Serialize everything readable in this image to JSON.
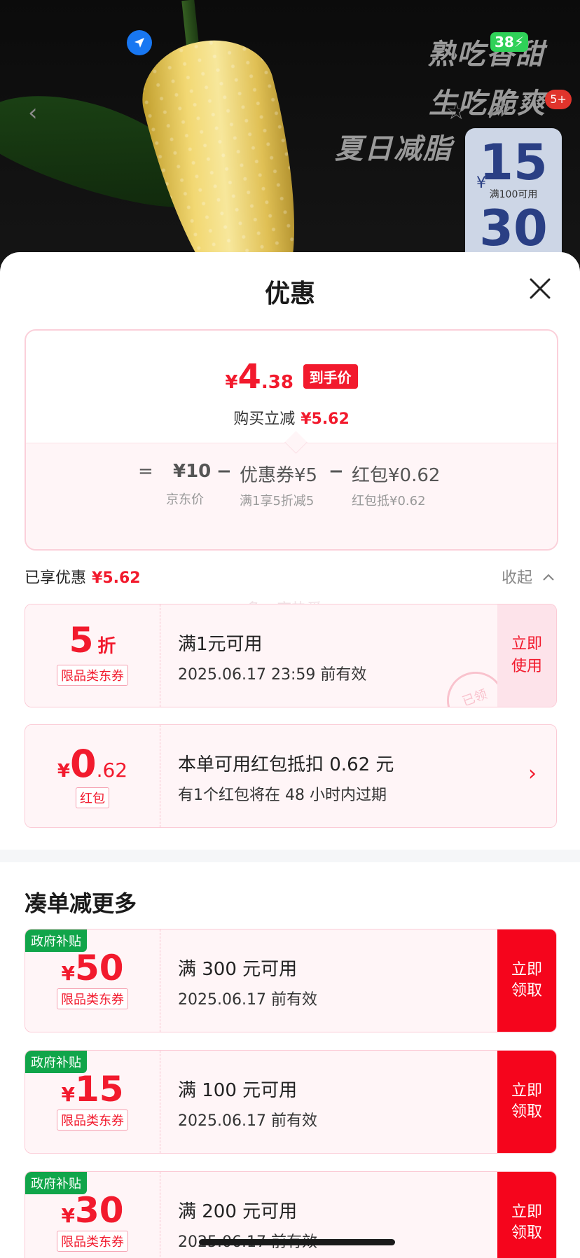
{
  "background": {
    "slogan_lines": [
      "熟吃香甜",
      "生吃脆爽",
      "夏日减脂"
    ],
    "battery": "38",
    "badge_count": "5+",
    "side_coupon": {
      "currency": "¥",
      "amount": "15",
      "condition": "满100可用",
      "amount2": "30"
    },
    "icons": [
      "location-arrow-icon",
      "back-icon",
      "star-icon",
      "share-icon"
    ]
  },
  "sheet": {
    "title": "优惠",
    "price_summary": {
      "currency": "¥",
      "price_int": "4",
      "price_dec": ".38",
      "price_tag": "到手价",
      "reduce_label": "购买立减",
      "reduce_amount": "¥5.62",
      "formula": {
        "eq": "=",
        "jd_price": "¥10",
        "minus1": "−",
        "coupon": "优惠券¥5",
        "minus2": "−",
        "redpacket": "红包¥0.62",
        "jd_label": "京东价",
        "coupon_note": "满1享5折减5",
        "redpacket_note": "红包抵¥0.62"
      }
    },
    "enjoyed_label": "已享优惠",
    "enjoyed_amount": "¥5.62",
    "collapse_label": "收起",
    "watermark": "多一度热爱",
    "applied": [
      {
        "value_int": "5",
        "value_unit": "折",
        "kind": "限品类东券",
        "title": "满1元可用",
        "expiry": "2025.06.17 23:59 前有效",
        "button": "立即使用",
        "stamp": "已领"
      },
      {
        "currency": "¥",
        "value_int": "0",
        "value_dec": ".62",
        "kind": "红包",
        "title": "本单可用红包抵扣 0.62 元",
        "expiry": "有1个红包将在 48 小时内过期"
      }
    ],
    "more_title": "凑单减更多",
    "more": [
      {
        "tag": "政府补贴",
        "currency": "¥",
        "amount": "50",
        "kind": "限品类东券",
        "title": "满 300 元可用",
        "expiry": "2025.06.17 前有效",
        "button": "立即领取"
      },
      {
        "tag": "政府补贴",
        "currency": "¥",
        "amount": "15",
        "kind": "限品类东券",
        "title": "满 100 元可用",
        "expiry": "2025.06.17 前有效",
        "button": "立即领取"
      },
      {
        "tag": "政府补贴",
        "currency": "¥",
        "amount": "30",
        "kind": "限品类东券",
        "title": "满 200 元可用",
        "expiry": "2025.06.17 前有效",
        "button": "立即领取"
      }
    ]
  },
  "colors": {
    "accent": "#f21a2d",
    "claim": "#f5051c",
    "gov_tag": "#11a54a",
    "card_bg": "#fff5f7"
  }
}
